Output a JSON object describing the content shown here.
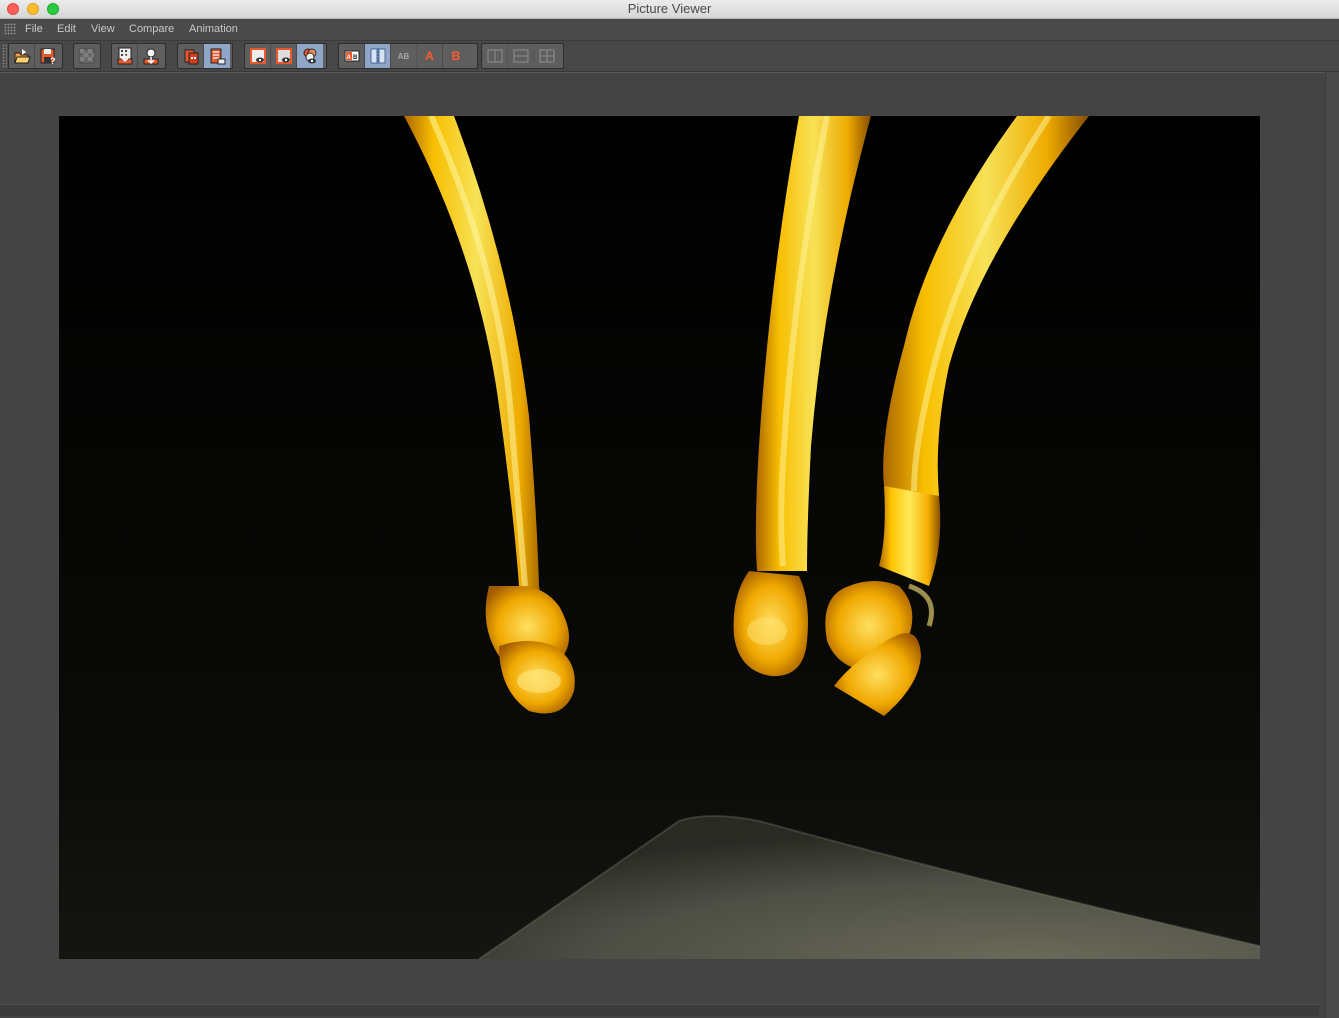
{
  "window": {
    "title": "Picture Viewer"
  },
  "menu": {
    "items": [
      {
        "label": "File"
      },
      {
        "label": "Edit"
      },
      {
        "label": "View"
      },
      {
        "label": "Compare"
      },
      {
        "label": "Animation"
      }
    ]
  },
  "toolbar": {
    "compare_ab_label": "AB",
    "compare_a_label": "A",
    "compare_b_label": "B"
  },
  "colors": {
    "accent_orange": "#e8582a",
    "active_button": "#8fa6c8",
    "honey_gold": "#f5b800"
  },
  "icons": [
    "open-file-icon",
    "save-as-icon",
    "checker-background-icon",
    "save-frame-icon",
    "render-region-icon",
    "layer-stack-icon",
    "layer-list-icon",
    "view-single-icon",
    "view-compare-icon",
    "view-channels-icon",
    "ab-compare-icon",
    "ab-split-icon",
    "ab-swap-icon",
    "set-a-icon",
    "set-b-icon",
    "layout-1-icon",
    "layout-2-icon",
    "layout-3-icon"
  ]
}
